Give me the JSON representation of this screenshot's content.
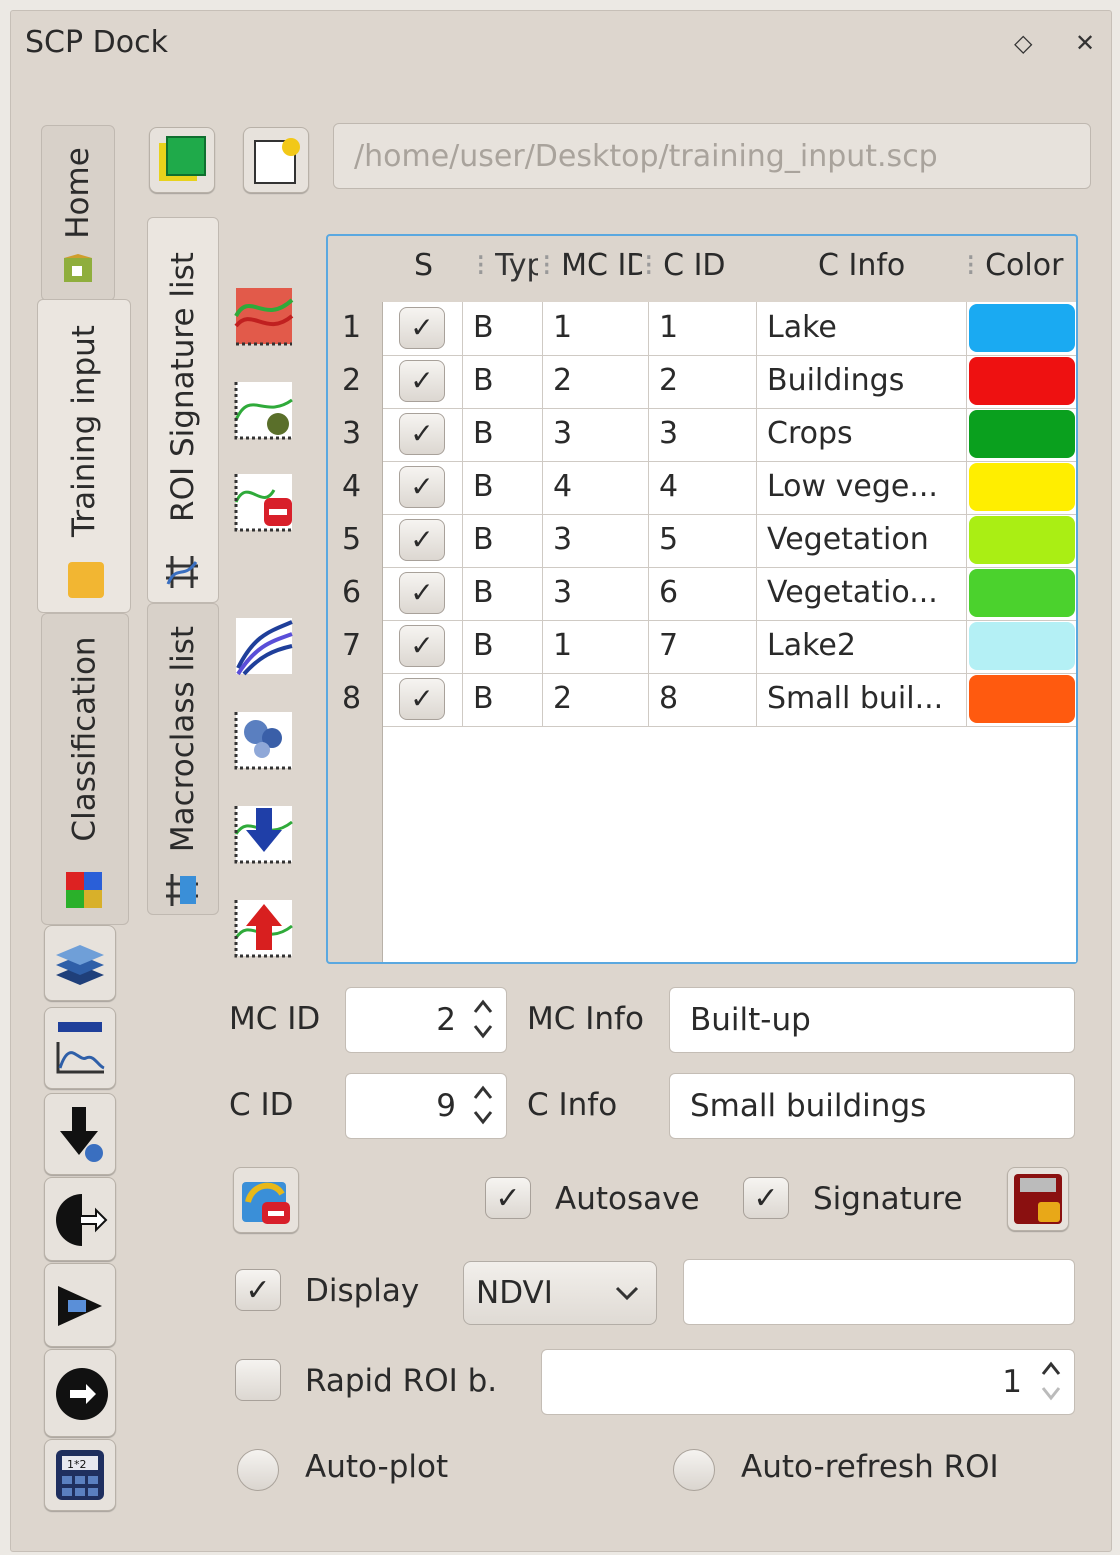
{
  "window": {
    "title": "SCP Dock",
    "float_icon": "◇",
    "close_icon": "✕"
  },
  "outer_tabs": {
    "home": "Home",
    "training": "Training input",
    "classification": "Classification"
  },
  "inner_tabs": {
    "roi": "ROI Signature list",
    "macro": "Macroclass list"
  },
  "file_path": "/home/user/Desktop/training_input.scp",
  "table": {
    "headers": {
      "s": "S",
      "type": "Type",
      "mc_id": "MC ID",
      "c_id": "C ID",
      "c_info": "C Info",
      "color": "Color"
    },
    "rows": [
      {
        "n": "1",
        "type": "B",
        "mc_id": "1",
        "c_id": "1",
        "c_info": "Lake",
        "color": "#1aaaf2"
      },
      {
        "n": "2",
        "type": "B",
        "mc_id": "2",
        "c_id": "2",
        "c_info": "Buildings",
        "color": "#ee1111"
      },
      {
        "n": "3",
        "type": "B",
        "mc_id": "3",
        "c_id": "3",
        "c_info": "Crops",
        "color": "#0aa01e"
      },
      {
        "n": "4",
        "type": "B",
        "mc_id": "4",
        "c_id": "4",
        "c_info": "Low vege...",
        "color": "#ffee00"
      },
      {
        "n": "5",
        "type": "B",
        "mc_id": "3",
        "c_id": "5",
        "c_info": "Vegetation",
        "color": "#aaee14"
      },
      {
        "n": "6",
        "type": "B",
        "mc_id": "3",
        "c_id": "6",
        "c_info": "Vegetatio...",
        "color": "#4bd22d"
      },
      {
        "n": "7",
        "type": "B",
        "mc_id": "1",
        "c_id": "7",
        "c_info": "Lake2",
        "color": "#b4f0f5"
      },
      {
        "n": "8",
        "type": "B",
        "mc_id": "2",
        "c_id": "8",
        "c_info": "Small buil...",
        "color": "#ff5a0f"
      }
    ]
  },
  "form": {
    "mc_id_label": "MC ID",
    "mc_id_value": "2",
    "mc_info_label": "MC Info",
    "mc_info_value": "Built-up",
    "c_id_label": "C ID",
    "c_id_value": "9",
    "c_info_label": "C Info",
    "c_info_value": "Small buildings",
    "autosave": "Autosave",
    "signature": "Signature",
    "display": "Display",
    "display_option": "NDVI",
    "display_extra": "",
    "rapid_roi": "Rapid ROI b.",
    "rapid_roi_value": "1",
    "auto_plot": "Auto-plot",
    "auto_refresh": "Auto-refresh ROI"
  }
}
